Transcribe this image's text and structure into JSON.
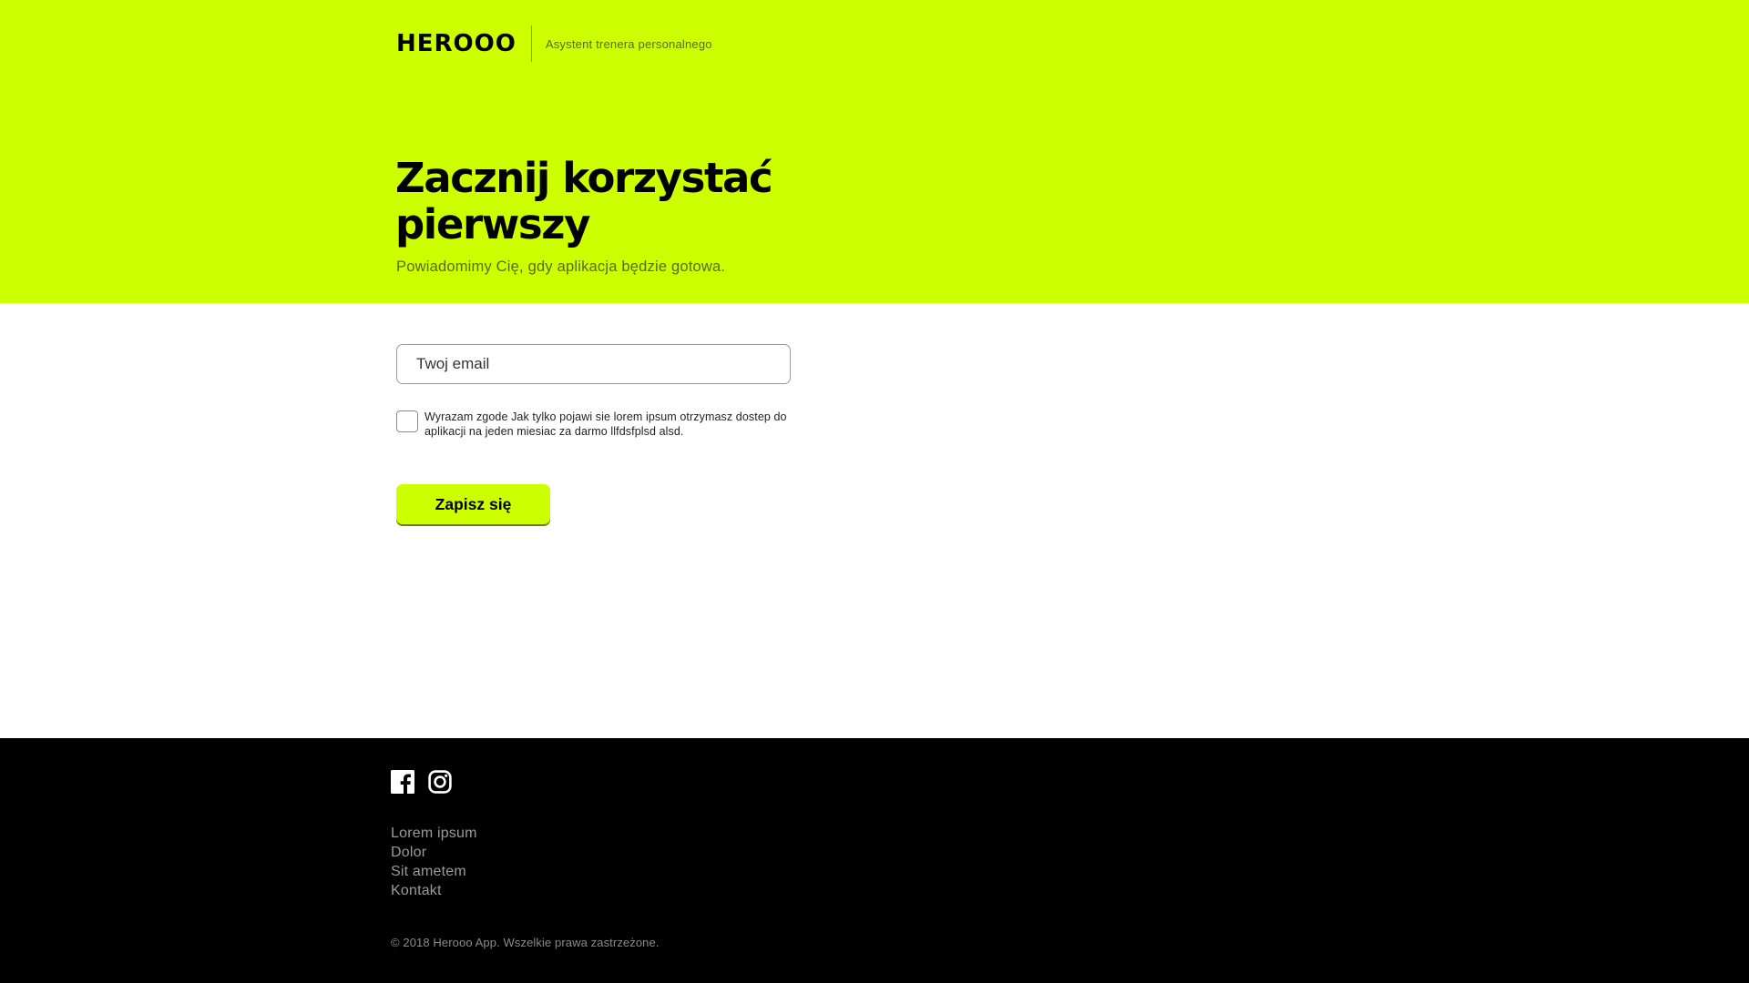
{
  "header": {
    "logo_text": "HEROOO",
    "tagline": "Asystent trenera personalnego"
  },
  "hero": {
    "headline_line1": "Zacznij korzystać",
    "headline_line2": "pierwszy",
    "subhead": "Powiadomimy Cię, gdy aplikacja będzie gotowa."
  },
  "form": {
    "email_placeholder": "Twoj email",
    "email_value": "",
    "consent_checked": false,
    "consent_text": "Wyrazam zgode Jak tylko pojawi sie lorem ipsum otrzymasz dostep do aplikacji na jeden miesiac za darmo llfdsfplsd alsd.",
    "submit_label": "Zapisz się"
  },
  "footer": {
    "social": [
      {
        "icon": "facebook-icon"
      },
      {
        "icon": "instagram-icon"
      }
    ],
    "links": [
      "Lorem ipsum",
      "Dolor",
      "Sit ametem",
      "Kontakt"
    ],
    "copyright": "© 2018 Herooo App. Wszelkie prawa zastrzeżone."
  },
  "colors": {
    "brand": "#ccff00",
    "footer_bg": "#000000",
    "text": "#000000"
  }
}
